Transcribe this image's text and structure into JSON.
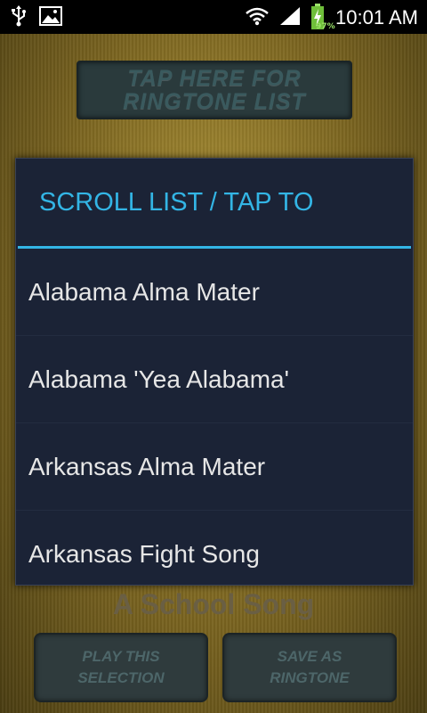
{
  "status_bar": {
    "time": "10:01 AM",
    "battery_percent": "97%",
    "icons": [
      "usb-icon",
      "image-icon",
      "wifi-icon",
      "signal-icon",
      "battery-charging-icon"
    ]
  },
  "app": {
    "top_button": {
      "line1": "TAP HERE FOR",
      "line2": "RINGTONE LIST"
    },
    "bottom_title": "A School Song",
    "play_button": {
      "line1": "PLAY THIS",
      "line2": "SELECTION"
    },
    "save_button": {
      "line1": "SAVE AS",
      "line2": "RINGTONE"
    }
  },
  "dialog": {
    "title": "SCROLL LIST / TAP TO",
    "items": [
      "Alabama Alma Mater",
      "Alabama 'Yea Alabama'",
      "Arkansas Alma Mater",
      "Arkansas Fight Song"
    ]
  },
  "colors": {
    "accent": "#33b5e5",
    "dialog_bg": "#1b2336",
    "app_gold": "#b59a3a"
  }
}
